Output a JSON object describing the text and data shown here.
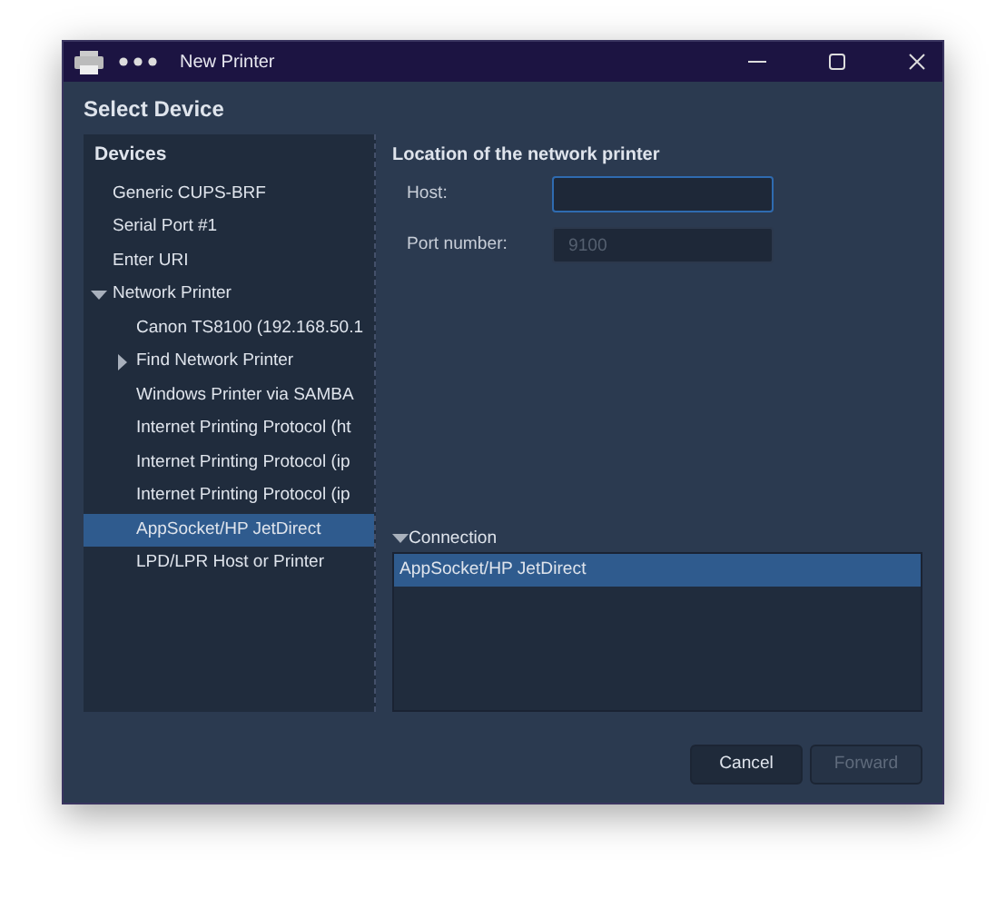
{
  "window": {
    "title": "New Printer"
  },
  "heading": "Select Device",
  "devices": {
    "title": "Devices",
    "items": [
      {
        "label": "Generic CUPS-BRF",
        "selected": false
      },
      {
        "label": "Serial Port #1",
        "selected": false
      },
      {
        "label": "Enter URI",
        "selected": false
      },
      {
        "label": "Network Printer",
        "selected": false,
        "expanded": true,
        "children": [
          {
            "label": "Canon TS8100 (192.168.50.1",
            "selected": false
          },
          {
            "label": "Find Network Printer",
            "selected": false,
            "expanded": false
          },
          {
            "label": "Windows Printer via SAMBA",
            "selected": false
          },
          {
            "label": "Internet Printing Protocol (ht",
            "selected": false
          },
          {
            "label": "Internet Printing Protocol (ip",
            "selected": false
          },
          {
            "label": "Internet Printing Protocol (ip",
            "selected": false
          },
          {
            "label": "AppSocket/HP JetDirect",
            "selected": true
          },
          {
            "label": "LPD/LPR Host or Printer",
            "selected": false
          }
        ]
      }
    ]
  },
  "location": {
    "title": "Location of the network printer",
    "fields": [
      {
        "label": "Host:",
        "focused": true,
        "disabled": false
      },
      {
        "label": "Port number:",
        "value": "9100",
        "focused": false,
        "disabled": true
      }
    ]
  },
  "connection": {
    "title": "Connection",
    "expanded": true,
    "items": [
      {
        "label": "AppSocket/HP JetDirect",
        "selected": true
      }
    ]
  },
  "buttons": [
    {
      "label": "Cancel",
      "disabled": false
    },
    {
      "label": "Forward",
      "disabled": true
    }
  ]
}
